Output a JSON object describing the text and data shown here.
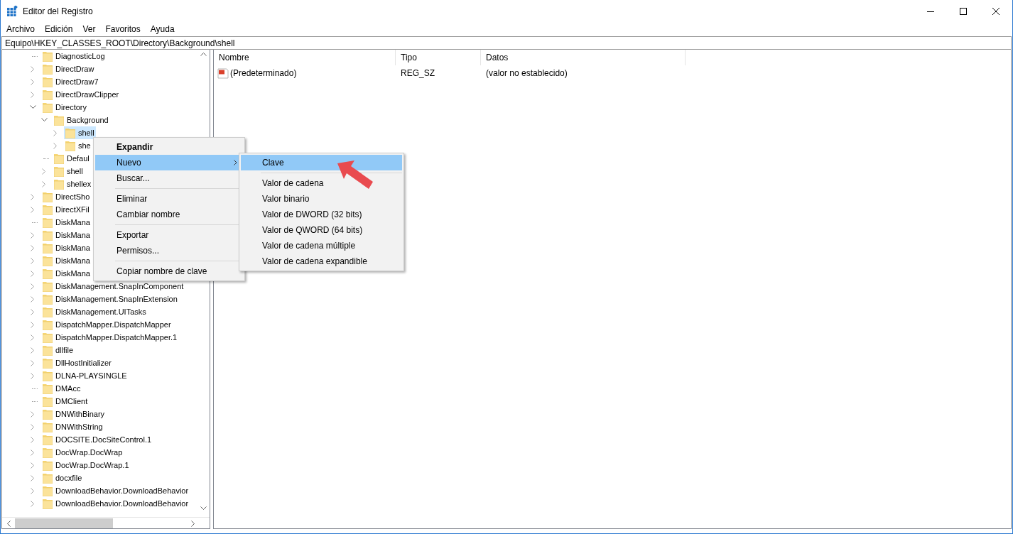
{
  "window": {
    "title": "Editor del Registro"
  },
  "menu_bar": [
    "Archivo",
    "Edición",
    "Ver",
    "Favoritos",
    "Ayuda"
  ],
  "address": "Equipo\\HKEY_CLASSES_ROOT\\Directory\\Background\\shell",
  "tree": [
    {
      "label": "DiagnosticLog",
      "kind": "leaf",
      "selected": false
    },
    {
      "label": "DirectDraw",
      "kind": "node",
      "expanded": false,
      "selected": false
    },
    {
      "label": "DirectDraw7",
      "kind": "node",
      "expanded": false,
      "selected": false
    },
    {
      "label": "DirectDrawClipper",
      "kind": "node",
      "expanded": false,
      "selected": false
    },
    {
      "label": "Directory",
      "kind": "node",
      "expanded": true,
      "selected": false,
      "children": [
        {
          "label": "Background",
          "kind": "node",
          "expanded": true,
          "selected": false,
          "children": [
            {
              "label": "shell",
              "kind": "node",
              "expanded": false,
              "selected": true
            },
            {
              "label": "she",
              "kind": "node",
              "expanded": false,
              "selected": false
            }
          ]
        },
        {
          "label": "Defaul",
          "kind": "leaf",
          "selected": false
        },
        {
          "label": "shell",
          "kind": "node",
          "expanded": false,
          "selected": false
        },
        {
          "label": "shellex",
          "kind": "node",
          "expanded": false,
          "selected": false
        }
      ]
    },
    {
      "label": "DirectSho",
      "kind": "node",
      "expanded": false,
      "selected": false
    },
    {
      "label": "DirectXFil",
      "kind": "node",
      "expanded": false,
      "selected": false
    },
    {
      "label": "DiskMana",
      "kind": "leaf",
      "selected": false
    },
    {
      "label": "DiskMana",
      "kind": "node",
      "expanded": false,
      "selected": false
    },
    {
      "label": "DiskMana",
      "kind": "node",
      "expanded": false,
      "selected": false
    },
    {
      "label": "DiskMana",
      "kind": "node",
      "expanded": false,
      "selected": false
    },
    {
      "label": "DiskMana",
      "kind": "node",
      "expanded": false,
      "selected": false
    },
    {
      "label": "DiskManagement.SnapInComponent",
      "kind": "node",
      "expanded": false,
      "selected": false
    },
    {
      "label": "DiskManagement.SnapInExtension",
      "kind": "node",
      "expanded": false,
      "selected": false
    },
    {
      "label": "DiskManagement.UITasks",
      "kind": "node",
      "expanded": false,
      "selected": false
    },
    {
      "label": "DispatchMapper.DispatchMapper",
      "kind": "node",
      "expanded": false,
      "selected": false
    },
    {
      "label": "DispatchMapper.DispatchMapper.1",
      "kind": "node",
      "expanded": false,
      "selected": false
    },
    {
      "label": "dllfile",
      "kind": "node",
      "expanded": false,
      "selected": false
    },
    {
      "label": "DllHostInitializer",
      "kind": "node",
      "expanded": false,
      "selected": false
    },
    {
      "label": "DLNA-PLAYSINGLE",
      "kind": "node",
      "expanded": false,
      "selected": false
    },
    {
      "label": "DMAcc",
      "kind": "leaf",
      "selected": false
    },
    {
      "label": "DMClient",
      "kind": "leaf",
      "selected": false
    },
    {
      "label": "DNWithBinary",
      "kind": "node",
      "expanded": false,
      "selected": false
    },
    {
      "label": "DNWithString",
      "kind": "node",
      "expanded": false,
      "selected": false
    },
    {
      "label": "DOCSITE.DocSiteControl.1",
      "kind": "node",
      "expanded": false,
      "selected": false
    },
    {
      "label": "DocWrap.DocWrap",
      "kind": "node",
      "expanded": false,
      "selected": false
    },
    {
      "label": "DocWrap.DocWrap.1",
      "kind": "node",
      "expanded": false,
      "selected": false
    },
    {
      "label": "docxfile",
      "kind": "node",
      "expanded": false,
      "selected": false
    },
    {
      "label": "DownloadBehavior.DownloadBehavior",
      "kind": "node",
      "expanded": false,
      "selected": false
    },
    {
      "label": "DownloadBehavior.DownloadBehavior",
      "kind": "node",
      "expanded": false,
      "selected": false
    }
  ],
  "values": {
    "columns": [
      "Nombre",
      "Tipo",
      "Datos"
    ],
    "rows": [
      {
        "name": "(Predeterminado)",
        "type": "REG_SZ",
        "data": "(valor no establecido)"
      }
    ]
  },
  "context_menu": [
    {
      "kind": "item",
      "label": "Expandir",
      "bold": true,
      "selected": false
    },
    {
      "kind": "submenu",
      "label": "Nuevo",
      "bold": false,
      "selected": true
    },
    {
      "kind": "item",
      "label": "Buscar...",
      "bold": false,
      "selected": false
    },
    {
      "kind": "separator"
    },
    {
      "kind": "item",
      "label": "Eliminar",
      "bold": false,
      "selected": false
    },
    {
      "kind": "item",
      "label": "Cambiar nombre",
      "bold": false,
      "selected": false
    },
    {
      "kind": "separator"
    },
    {
      "kind": "item",
      "label": "Exportar",
      "bold": false,
      "selected": false
    },
    {
      "kind": "item",
      "label": "Permisos...",
      "bold": false,
      "selected": false
    },
    {
      "kind": "separator"
    },
    {
      "kind": "item",
      "label": "Copiar nombre de clave",
      "bold": false,
      "selected": false
    }
  ],
  "submenu": [
    {
      "kind": "item",
      "label": "Clave",
      "bold": false,
      "selected": true
    },
    {
      "kind": "separator"
    },
    {
      "kind": "item",
      "label": "Valor de cadena",
      "bold": false,
      "selected": false
    },
    {
      "kind": "item",
      "label": "Valor binario",
      "bold": false,
      "selected": false
    },
    {
      "kind": "item",
      "label": "Valor de DWORD (32 bits)",
      "bold": false,
      "selected": false
    },
    {
      "kind": "item",
      "label": "Valor de QWORD (64 bits)",
      "bold": false,
      "selected": false
    },
    {
      "kind": "item",
      "label": "Valor de cadena múltiple",
      "bold": false,
      "selected": false
    },
    {
      "kind": "item",
      "label": "Valor de cadena expandible",
      "bold": false,
      "selected": false
    }
  ]
}
